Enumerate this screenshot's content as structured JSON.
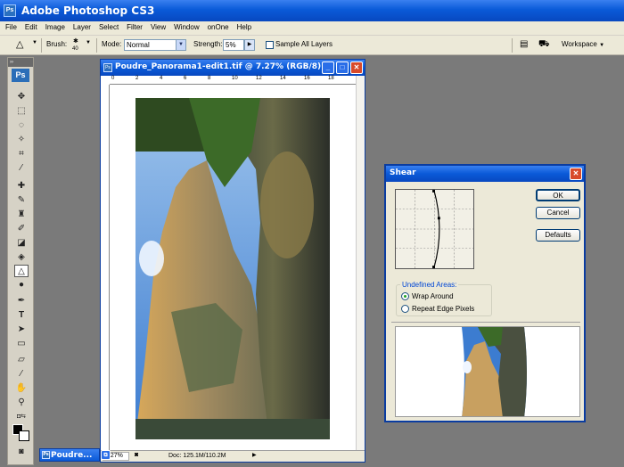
{
  "app": {
    "title": "Adobe Photoshop CS3",
    "logo": "Ps"
  },
  "menu": [
    "File",
    "Edit",
    "Image",
    "Layer",
    "Select",
    "Filter",
    "View",
    "Window",
    "onOne",
    "Help"
  ],
  "options": {
    "brush_label": "Brush:",
    "brush_size": "40",
    "mode_label": "Mode:",
    "mode_value": "Normal",
    "strength_label": "Strength:",
    "strength_value": "5%",
    "sample_all_label": "Sample All Layers",
    "workspace_label": "Workspace"
  },
  "toolbox": {
    "logo": "Ps"
  },
  "document": {
    "title": "Poudre_Panorama1-edit1.tif @ 7.27% (RGB/8)",
    "ruler_marks": [
      "0",
      "2",
      "4",
      "6",
      "8",
      "10",
      "12",
      "14",
      "16",
      "18"
    ],
    "zoom": "7.27%",
    "doc_size": "Doc: 125.1M/110.2M",
    "minimized_title": "Poudre..."
  },
  "shear": {
    "title": "Shear",
    "ok_label": "OK",
    "cancel_label": "Cancel",
    "defaults_label": "Defaults",
    "undefined_areas_label": "Undefined Areas:",
    "wrap_around_label": "Wrap Around",
    "repeat_edge_label": "Repeat Edge Pixels",
    "selected_option": "Wrap Around"
  },
  "colors": {
    "titlebar": "#0a5ad8",
    "chrome": "#ece9d8",
    "workspace": "#7a7a7a",
    "close": "#d84a2a"
  }
}
